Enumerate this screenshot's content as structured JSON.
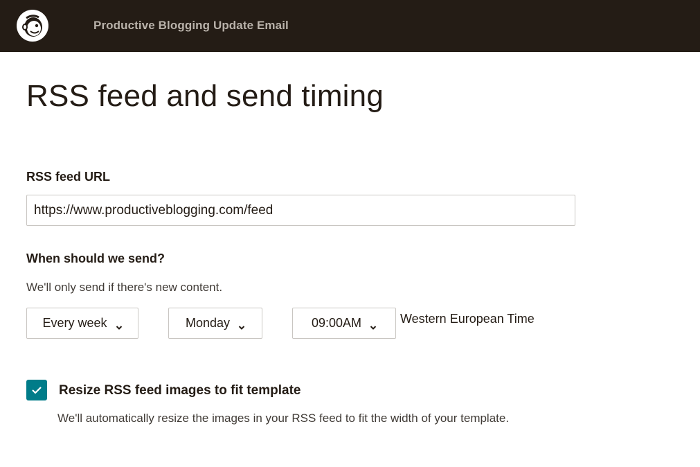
{
  "header": {
    "campaign_name": "Productive Blogging Update Email",
    "logo_icon": "mailchimp-freddie-logo",
    "background_color": "#241c15"
  },
  "main": {
    "title": "RSS feed and send timing",
    "rss": {
      "label": "RSS feed URL",
      "value": "https://www.productiveblogging.com/feed"
    },
    "schedule": {
      "label": "When should we send?",
      "helper": "We'll only send if there's new content.",
      "frequency": "Every week",
      "day": "Monday",
      "time": "09:00AM",
      "timezone": "Western European Time"
    },
    "resize": {
      "checked": true,
      "label": "Resize RSS feed images to fit template",
      "description": "We'll automatically resize the images in your RSS feed to fit the width of your template.",
      "accent_color": "#007c89"
    }
  }
}
